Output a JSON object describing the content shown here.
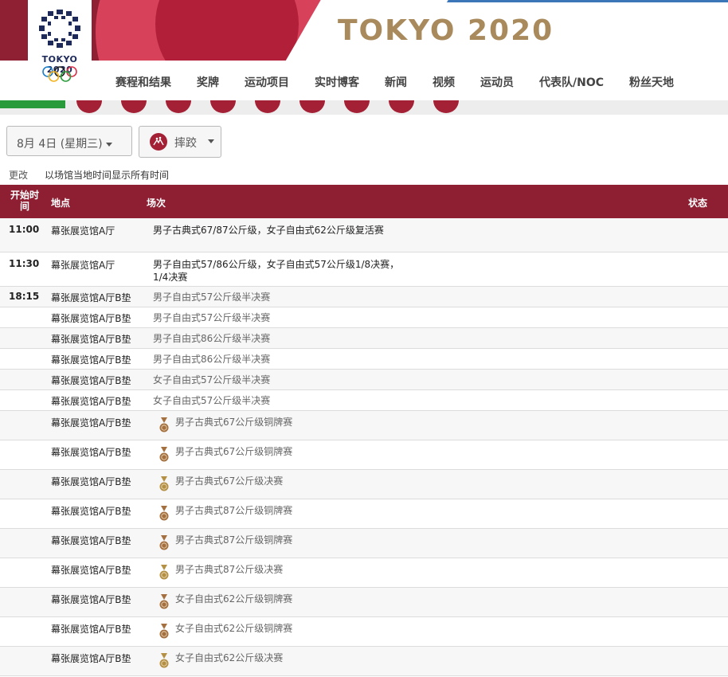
{
  "brand": {
    "title": "TOKYO 2020",
    "logo_text": "TOKYO 2020"
  },
  "nav": {
    "items": [
      "赛程和结果",
      "奖牌",
      "运动项目",
      "实时博客",
      "新闻",
      "视频",
      "运动员",
      "代表队/NOC",
      "粉丝天地"
    ]
  },
  "filters": {
    "date": "8月 4日 (星期三)",
    "sport": "摔跤"
  },
  "notes": {
    "change": "更改",
    "timezone": "以场馆当地时间显示所有时间"
  },
  "table": {
    "headers": {
      "time": "开始时间",
      "venue": "地点",
      "session": "场次",
      "status": "状态"
    },
    "rows": [
      {
        "time": "11:00",
        "venue": "幕张展览馆A厅",
        "event": "男子古典式67/87公斤级，女子自由式62公斤级复活赛",
        "medal": false
      },
      {
        "time": "11:30",
        "venue": "幕张展览馆A厅",
        "event": "男子自由式57/86公斤级，女子自由式57公斤级1/8决赛，1/4决赛",
        "medal": false
      },
      {
        "time": "18:15",
        "venue": "幕张展览馆A厅B垫",
        "event": "男子自由式57公斤级半决赛",
        "medal": false
      },
      {
        "time": "",
        "venue": "幕张展览馆A厅B垫",
        "event": "男子自由式57公斤级半决赛",
        "medal": false
      },
      {
        "time": "",
        "venue": "幕张展览馆A厅B垫",
        "event": "男子自由式86公斤级半决赛",
        "medal": false
      },
      {
        "time": "",
        "venue": "幕张展览馆A厅B垫",
        "event": "男子自由式86公斤级半决赛",
        "medal": false
      },
      {
        "time": "",
        "venue": "幕张展览馆A厅B垫",
        "event": "女子自由式57公斤级半决赛",
        "medal": false
      },
      {
        "time": "",
        "venue": "幕张展览馆A厅B垫",
        "event": "女子自由式57公斤级半决赛",
        "medal": false
      },
      {
        "time": "",
        "venue": "幕张展览馆A厅B垫",
        "event": "男子古典式67公斤级铜牌赛",
        "medal": true,
        "medal_type": "bronze"
      },
      {
        "time": "",
        "venue": "幕张展览馆A厅B垫",
        "event": "男子古典式67公斤级铜牌赛",
        "medal": true,
        "medal_type": "bronze"
      },
      {
        "time": "",
        "venue": "幕张展览馆A厅B垫",
        "event": "男子古典式67公斤级决赛",
        "medal": true,
        "medal_type": "gold"
      },
      {
        "time": "",
        "venue": "幕张展览馆A厅B垫",
        "event": "男子古典式87公斤级铜牌赛",
        "medal": true,
        "medal_type": "bronze"
      },
      {
        "time": "",
        "venue": "幕张展览馆A厅B垫",
        "event": "男子古典式87公斤级铜牌赛",
        "medal": true,
        "medal_type": "bronze"
      },
      {
        "time": "",
        "venue": "幕张展览馆A厅B垫",
        "event": "男子古典式87公斤级决赛",
        "medal": true,
        "medal_type": "gold"
      },
      {
        "time": "",
        "venue": "幕张展览馆A厅B垫",
        "event": "女子自由式62公斤级铜牌赛",
        "medal": true,
        "medal_type": "bronze"
      },
      {
        "time": "",
        "venue": "幕张展览馆A厅B垫",
        "event": "女子自由式62公斤级铜牌赛",
        "medal": true,
        "medal_type": "bronze"
      },
      {
        "time": "",
        "venue": "幕张展览馆A厅B垫",
        "event": "女子自由式62公斤级决赛",
        "medal": true,
        "medal_type": "gold"
      }
    ]
  },
  "icons": {
    "logo": "tokyo-2020-emblem-icon",
    "rings": "olympic-rings-icon",
    "sport": "wrestling-icon",
    "medal": "medal-icon",
    "caret": "caret-down-icon"
  },
  "colors": {
    "brand_red": "#8e1f32",
    "gold_text": "#a98a5d",
    "bronze": "#a5703f"
  }
}
